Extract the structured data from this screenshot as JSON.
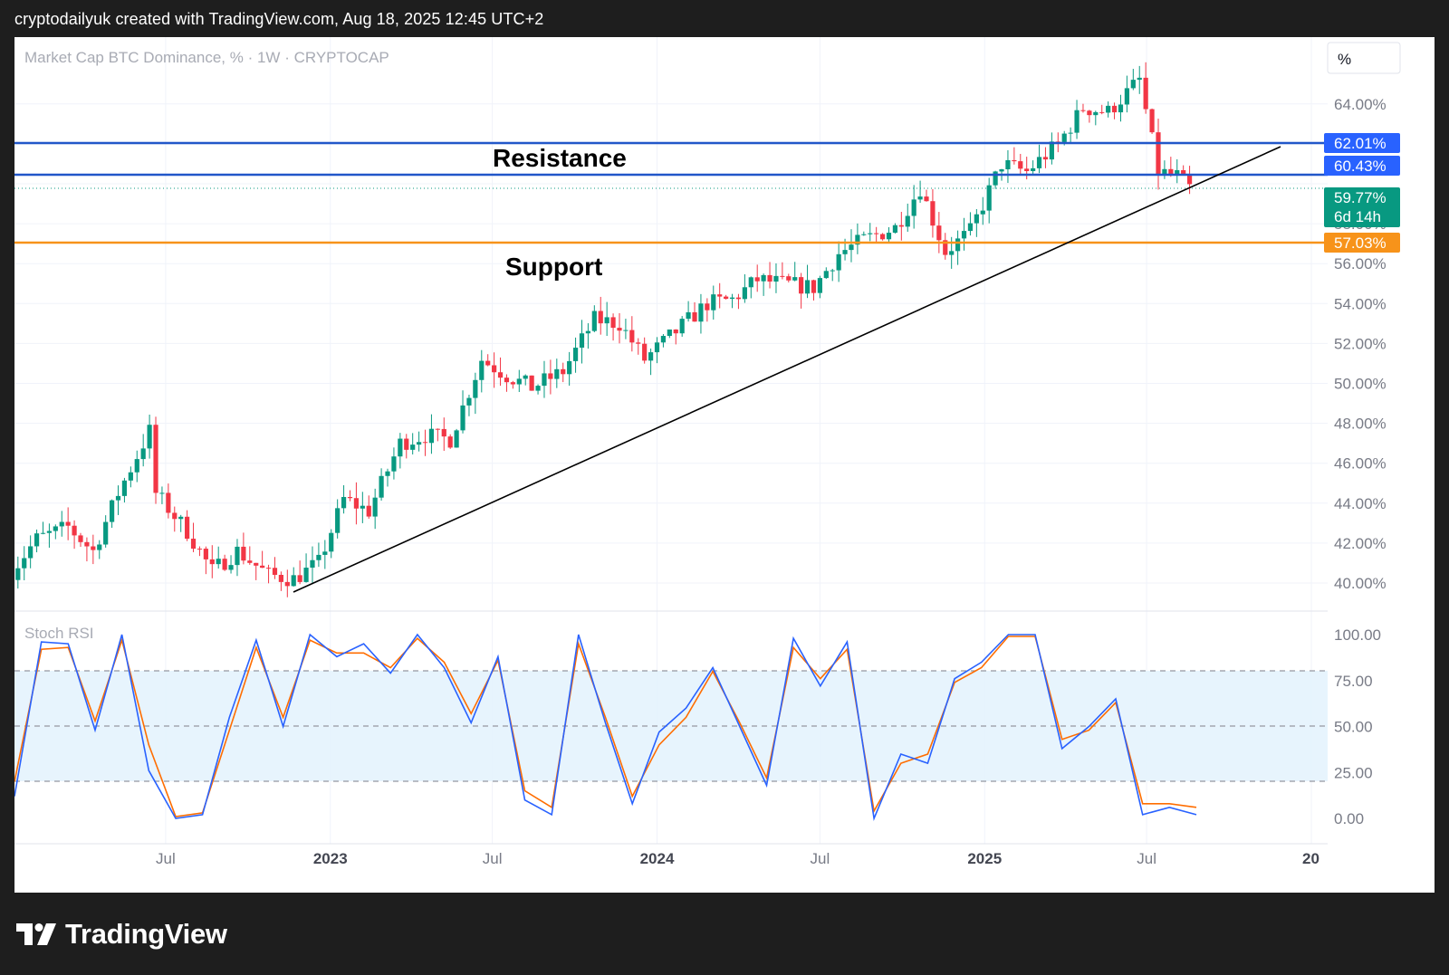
{
  "header": {
    "text": "cryptodailyuk created with TradingView.com, Aug 18, 2025 12:45 UTC+2"
  },
  "chart": {
    "title": "Market Cap BTC Dominance, % · 1W · CRYPTOCAP",
    "currency_label": "%",
    "resistance_label": "Resistance",
    "support_label": "Support",
    "indicator_label": "Stoch RSI",
    "colors": {
      "up": "#089981",
      "down": "#f23645",
      "resistance": "#2157c9",
      "support": "#f7931a",
      "k_line": "#2962ff",
      "d_line": "#ff6d00",
      "badge_blue": "#2962ff",
      "badge_green": "#089981",
      "badge_orange": "#f7931a"
    },
    "price_axis_labels": [
      "64.00%",
      "58.00%",
      "56.00%",
      "54.00%",
      "52.00%",
      "50.00%",
      "48.00%",
      "46.00%",
      "44.00%",
      "42.00%",
      "40.00%"
    ],
    "price_badges": [
      {
        "text": "62.01%",
        "color": "blue"
      },
      {
        "text": "60.43%",
        "color": "blue"
      },
      {
        "text": "59.77%",
        "sub": "6d 14h",
        "color": "green"
      },
      {
        "text": "57.03%",
        "color": "orange"
      }
    ],
    "rsi_axis_labels": [
      "100.00",
      "75.00",
      "50.00",
      "25.00",
      "0.00"
    ],
    "time_axis_labels": [
      {
        "text": "Jul",
        "bold": false
      },
      {
        "text": "2023",
        "bold": true
      },
      {
        "text": "Jul",
        "bold": false
      },
      {
        "text": "2024",
        "bold": true
      },
      {
        "text": "Jul",
        "bold": false
      },
      {
        "text": "2025",
        "bold": true
      },
      {
        "text": "Jul",
        "bold": false
      },
      {
        "text": "20",
        "bold": true
      }
    ]
  },
  "chart_data": {
    "type": "candlestick",
    "symbol": "CRYPTOCAP",
    "interval": "1W",
    "ylim": [
      39,
      66
    ],
    "horizontal_lines": [
      {
        "name": "Resistance",
        "value": 62.01
      },
      {
        "name": "Resistance",
        "value": 60.43
      },
      {
        "name": "Support",
        "value": 57.03
      }
    ],
    "trendline": {
      "from": {
        "date": "2022-11-21",
        "value": 39.6
      },
      "to": {
        "date": "2025-11-17",
        "value": 61.9
      }
    },
    "last_price": 59.77,
    "candles": [
      {
        "date": "2022-01-10",
        "close": 40.6
      },
      {
        "date": "2022-02-07",
        "close": 42.2
      },
      {
        "date": "2022-03-14",
        "close": 42.8
      },
      {
        "date": "2022-04-11",
        "close": 41.6
      },
      {
        "date": "2022-05-09",
        "close": 44.5
      },
      {
        "date": "2022-06-13",
        "close": 47.6
      },
      {
        "date": "2022-06-20",
        "close": 44.5
      },
      {
        "date": "2022-07-25",
        "close": 42.6
      },
      {
        "date": "2022-08-22",
        "close": 40.6
      },
      {
        "date": "2022-09-19",
        "close": 41.6
      },
      {
        "date": "2022-10-24",
        "close": 40.4
      },
      {
        "date": "2022-11-21",
        "close": 40.2
      },
      {
        "date": "2022-12-19",
        "close": 41.0
      },
      {
        "date": "2023-01-16",
        "close": 44.2
      },
      {
        "date": "2023-02-13",
        "close": 43.6
      },
      {
        "date": "2023-03-20",
        "close": 47.0
      },
      {
        "date": "2023-04-17",
        "close": 47.4
      },
      {
        "date": "2023-05-15",
        "close": 47.2
      },
      {
        "date": "2023-06-19",
        "close": 51.2
      },
      {
        "date": "2023-07-17",
        "close": 50.4
      },
      {
        "date": "2023-08-14",
        "close": 49.8
      },
      {
        "date": "2023-09-18",
        "close": 50.6
      },
      {
        "date": "2023-10-23",
        "close": 53.2
      },
      {
        "date": "2023-11-20",
        "close": 53.0
      },
      {
        "date": "2023-12-18",
        "close": 51.2
      },
      {
        "date": "2024-01-22",
        "close": 52.6
      },
      {
        "date": "2024-02-26",
        "close": 54.0
      },
      {
        "date": "2024-03-25",
        "close": 54.2
      },
      {
        "date": "2024-04-22",
        "close": 55.2
      },
      {
        "date": "2024-05-20",
        "close": 55.0
      },
      {
        "date": "2024-06-24",
        "close": 54.8
      },
      {
        "date": "2024-07-22",
        "close": 56.5
      },
      {
        "date": "2024-08-19",
        "close": 57.2
      },
      {
        "date": "2024-09-23",
        "close": 57.8
      },
      {
        "date": "2024-10-21",
        "close": 59.8
      },
      {
        "date": "2024-11-18",
        "close": 56.6
      },
      {
        "date": "2024-12-16",
        "close": 57.6
      },
      {
        "date": "2025-01-20",
        "close": 61.0
      },
      {
        "date": "2025-02-17",
        "close": 60.6
      },
      {
        "date": "2025-03-24",
        "close": 62.0
      },
      {
        "date": "2025-04-21",
        "close": 63.8
      },
      {
        "date": "2025-05-19",
        "close": 63.6
      },
      {
        "date": "2025-06-23",
        "close": 65.2
      },
      {
        "date": "2025-07-14",
        "close": 60.6
      },
      {
        "date": "2025-08-04",
        "close": 60.4
      },
      {
        "date": "2025-08-18",
        "close": 59.77
      }
    ],
    "stoch_rsi": {
      "ylim": [
        0,
        100
      ],
      "bands": [
        20,
        50,
        80
      ],
      "series": [
        {
          "name": "K",
          "values": [
            12,
            96,
            95,
            48,
            100,
            26,
            0,
            2,
            55,
            97,
            50,
            100,
            88,
            95,
            79,
            100,
            82,
            52,
            88,
            10,
            2,
            100,
            52,
            8,
            47,
            60,
            82,
            50,
            18,
            98,
            72,
            96,
            0,
            35,
            30,
            76,
            85,
            100,
            100,
            38,
            50,
            65,
            2,
            6,
            2
          ]
        },
        {
          "name": "D",
          "values": [
            20,
            92,
            93,
            53,
            97,
            40,
            1,
            3,
            48,
            93,
            55,
            97,
            90,
            90,
            82,
            98,
            85,
            57,
            86,
            15,
            6,
            95,
            55,
            12,
            40,
            55,
            80,
            52,
            22,
            93,
            76,
            92,
            4,
            30,
            35,
            74,
            82,
            99,
            99,
            43,
            48,
            63,
            8,
            8,
            6
          ]
        }
      ]
    }
  }
}
